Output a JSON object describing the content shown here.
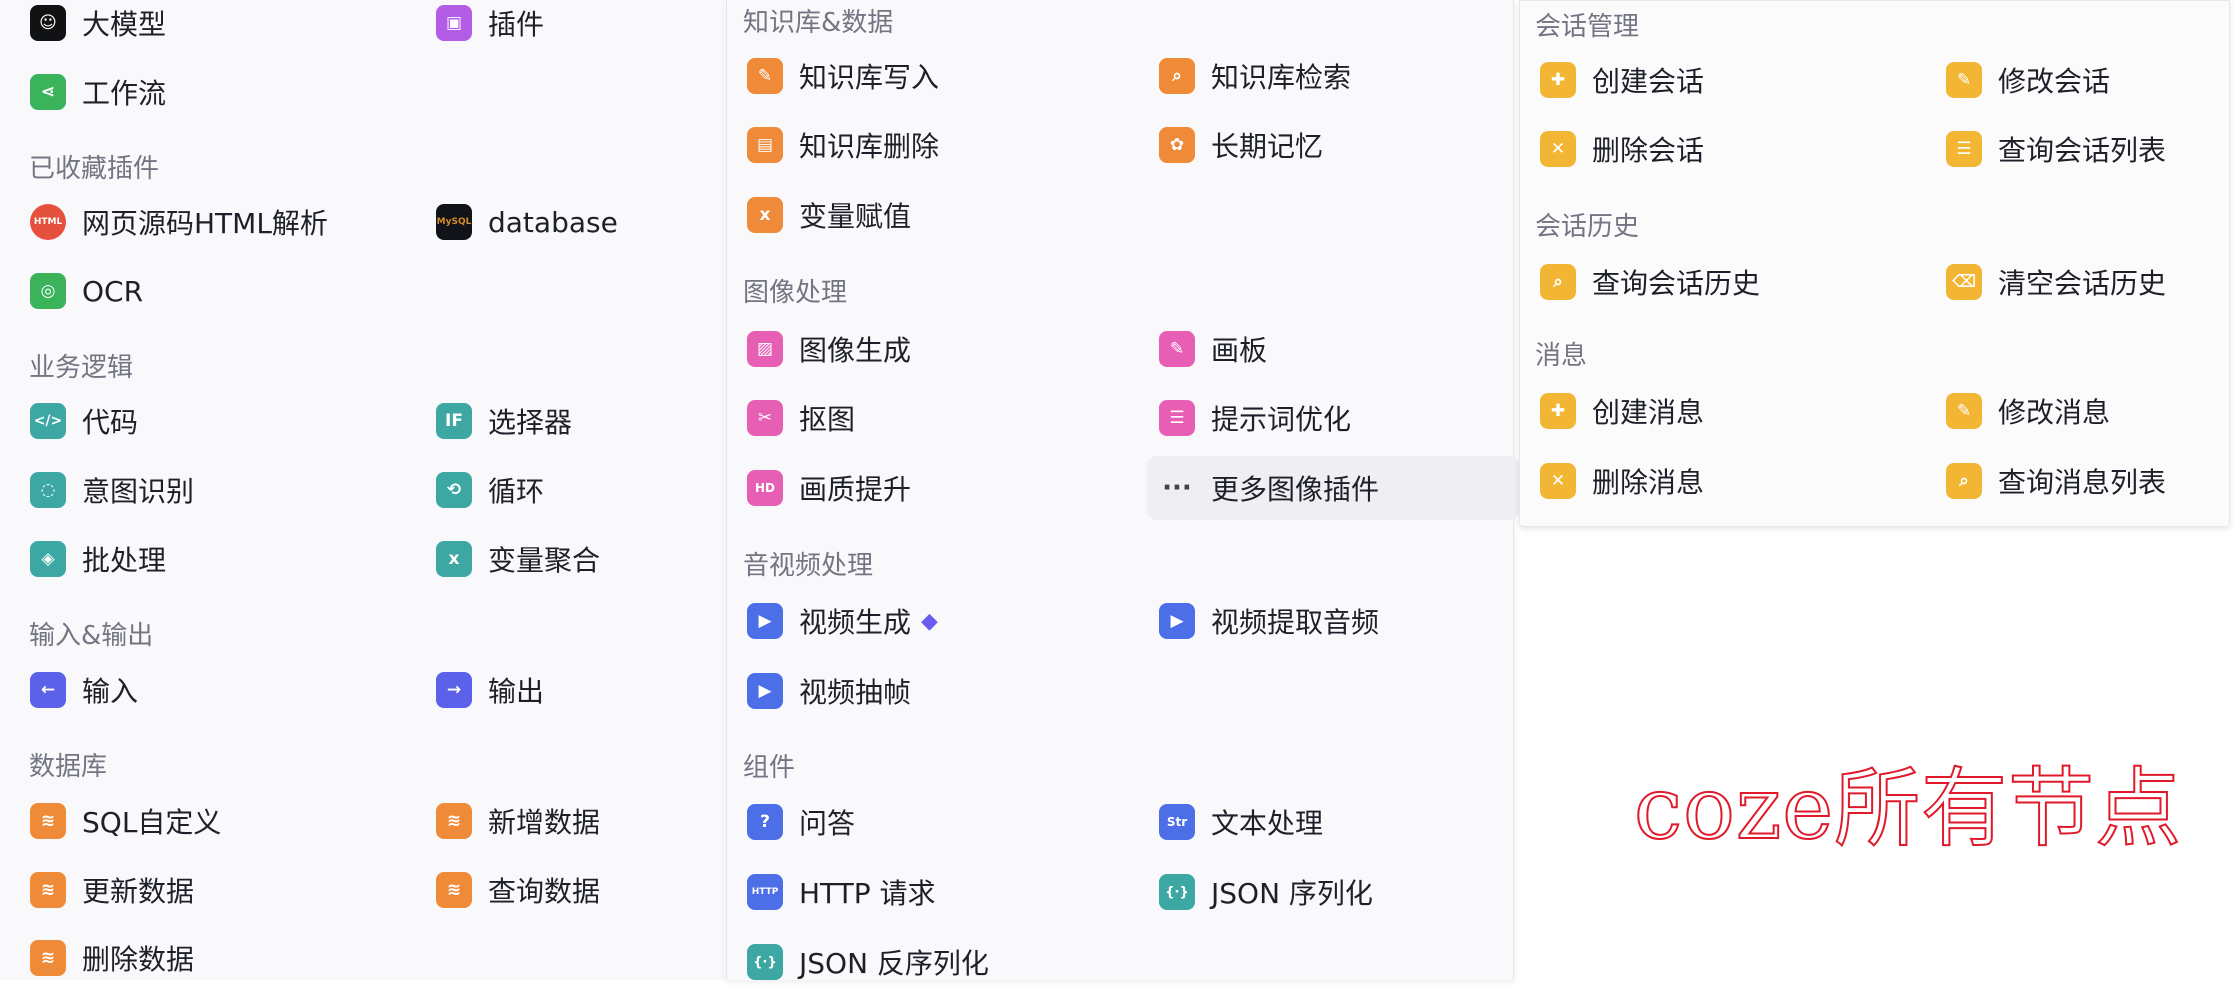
{
  "left": {
    "top_items": [
      {
        "label": "大模型",
        "icon": "llm-icon"
      },
      {
        "label": "插件",
        "icon": "plugin-cube-icon"
      },
      {
        "label": "工作流",
        "icon": "workflow-icon"
      }
    ],
    "sections": [
      {
        "title": "已收藏插件",
        "items": [
          {
            "label": "网页源码HTML解析",
            "icon": "html-icon",
            "glyph": "HTML"
          },
          {
            "label": "database",
            "icon": "mysql-icon",
            "glyph": "MySQL"
          },
          {
            "label": "OCR",
            "icon": "ocr-icon"
          }
        ]
      },
      {
        "title": "业务逻辑",
        "items": [
          {
            "label": "代码",
            "icon": "code-icon",
            "glyph": "</>"
          },
          {
            "label": "选择器",
            "icon": "if-icon",
            "glyph": "IF"
          },
          {
            "label": "意图识别",
            "icon": "intent-icon"
          },
          {
            "label": "循环",
            "icon": "loop-icon",
            "glyph": "⟲"
          },
          {
            "label": "批处理",
            "icon": "batch-icon"
          },
          {
            "label": "变量聚合",
            "icon": "variable-merge-icon",
            "glyph": "x"
          }
        ]
      },
      {
        "title": "输入&输出",
        "items": [
          {
            "label": "输入",
            "icon": "input-icon",
            "glyph": "←"
          },
          {
            "label": "输出",
            "icon": "output-icon",
            "glyph": "→"
          }
        ]
      },
      {
        "title": "数据库",
        "items": [
          {
            "label": "SQL自定义",
            "icon": "sql-icon"
          },
          {
            "label": "新增数据",
            "icon": "add-data-icon"
          },
          {
            "label": "更新数据",
            "icon": "update-data-icon"
          },
          {
            "label": "查询数据",
            "icon": "query-data-icon"
          },
          {
            "label": "删除数据",
            "icon": "delete-data-icon"
          }
        ]
      }
    ]
  },
  "mid": {
    "sections": [
      {
        "title": "知识库&数据",
        "items": [
          {
            "label": "知识库写入",
            "icon": "kb-write-icon"
          },
          {
            "label": "知识库检索",
            "icon": "kb-search-icon"
          },
          {
            "label": "知识库删除",
            "icon": "kb-delete-icon"
          },
          {
            "label": "长期记忆",
            "icon": "memory-icon"
          },
          {
            "label": "变量赋值",
            "icon": "variable-assign-icon",
            "glyph": "x"
          }
        ]
      },
      {
        "title": "图像处理",
        "items": [
          {
            "label": "图像生成",
            "icon": "image-gen-icon"
          },
          {
            "label": "画板",
            "icon": "canvas-icon"
          },
          {
            "label": "抠图",
            "icon": "cutout-icon"
          },
          {
            "label": "提示词优化",
            "icon": "prompt-optimize-icon"
          },
          {
            "label": "画质提升",
            "icon": "hd-icon",
            "glyph": "HD"
          },
          {
            "label": "更多图像插件",
            "icon": "more-icon",
            "glyph": "···"
          }
        ]
      },
      {
        "title": "音视频处理",
        "items": [
          {
            "label": "视频生成",
            "icon": "video-gen-icon",
            "glyph": "▶",
            "badge": "diamond-icon"
          },
          {
            "label": "视频提取音频",
            "icon": "video-audio-icon",
            "glyph": "▶"
          },
          {
            "label": "视频抽帧",
            "icon": "video-frame-icon",
            "glyph": "▶"
          }
        ]
      },
      {
        "title": "组件",
        "items": [
          {
            "label": "问答",
            "icon": "qa-icon",
            "glyph": "?"
          },
          {
            "label": "文本处理",
            "icon": "text-process-icon",
            "glyph": "Str"
          },
          {
            "label": "HTTP 请求",
            "icon": "http-icon",
            "glyph": "HTTP"
          },
          {
            "label": "JSON 序列化",
            "icon": "json-serialize-icon",
            "glyph": "{·}"
          },
          {
            "label": "JSON 反序列化",
            "icon": "json-deserialize-icon",
            "glyph": "{·}"
          }
        ]
      }
    ]
  },
  "right": {
    "sections": [
      {
        "title": "会话管理",
        "items": [
          {
            "label": "创建会话",
            "icon": "create-conversation-icon"
          },
          {
            "label": "修改会话",
            "icon": "edit-conversation-icon"
          },
          {
            "label": "删除会话",
            "icon": "delete-conversation-icon"
          },
          {
            "label": "查询会话列表",
            "icon": "list-conversation-icon"
          }
        ]
      },
      {
        "title": "会话历史",
        "items": [
          {
            "label": "查询会话历史",
            "icon": "query-history-icon"
          },
          {
            "label": "清空会话历史",
            "icon": "clear-history-icon"
          }
        ]
      },
      {
        "title": "消息",
        "items": [
          {
            "label": "创建消息",
            "icon": "create-message-icon"
          },
          {
            "label": "修改消息",
            "icon": "edit-message-icon"
          },
          {
            "label": "删除消息",
            "icon": "delete-message-icon"
          },
          {
            "label": "查询消息列表",
            "icon": "list-message-icon"
          }
        ]
      }
    ]
  },
  "watermark": "coze所有节点",
  "colors": {
    "section_title": "#737583",
    "label": "#1e2029",
    "panel_bg": "#f9f9fb",
    "watermark": "#e01a2a"
  }
}
